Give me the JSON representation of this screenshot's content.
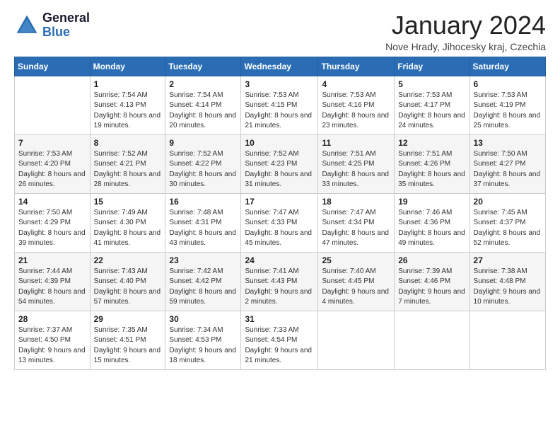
{
  "logo": {
    "line1": "General",
    "line2": "Blue"
  },
  "title": "January 2024",
  "subtitle": "Nove Hrady, Jihocesky kraj, Czechia",
  "days_header": [
    "Sunday",
    "Monday",
    "Tuesday",
    "Wednesday",
    "Thursday",
    "Friday",
    "Saturday"
  ],
  "weeks": [
    [
      {
        "day": "",
        "sunrise": "",
        "sunset": "",
        "daylight": ""
      },
      {
        "day": "1",
        "sunrise": "Sunrise: 7:54 AM",
        "sunset": "Sunset: 4:13 PM",
        "daylight": "Daylight: 8 hours and 19 minutes."
      },
      {
        "day": "2",
        "sunrise": "Sunrise: 7:54 AM",
        "sunset": "Sunset: 4:14 PM",
        "daylight": "Daylight: 8 hours and 20 minutes."
      },
      {
        "day": "3",
        "sunrise": "Sunrise: 7:53 AM",
        "sunset": "Sunset: 4:15 PM",
        "daylight": "Daylight: 8 hours and 21 minutes."
      },
      {
        "day": "4",
        "sunrise": "Sunrise: 7:53 AM",
        "sunset": "Sunset: 4:16 PM",
        "daylight": "Daylight: 8 hours and 23 minutes."
      },
      {
        "day": "5",
        "sunrise": "Sunrise: 7:53 AM",
        "sunset": "Sunset: 4:17 PM",
        "daylight": "Daylight: 8 hours and 24 minutes."
      },
      {
        "day": "6",
        "sunrise": "Sunrise: 7:53 AM",
        "sunset": "Sunset: 4:19 PM",
        "daylight": "Daylight: 8 hours and 25 minutes."
      }
    ],
    [
      {
        "day": "7",
        "sunrise": "Sunrise: 7:53 AM",
        "sunset": "Sunset: 4:20 PM",
        "daylight": "Daylight: 8 hours and 26 minutes."
      },
      {
        "day": "8",
        "sunrise": "Sunrise: 7:52 AM",
        "sunset": "Sunset: 4:21 PM",
        "daylight": "Daylight: 8 hours and 28 minutes."
      },
      {
        "day": "9",
        "sunrise": "Sunrise: 7:52 AM",
        "sunset": "Sunset: 4:22 PM",
        "daylight": "Daylight: 8 hours and 30 minutes."
      },
      {
        "day": "10",
        "sunrise": "Sunrise: 7:52 AM",
        "sunset": "Sunset: 4:23 PM",
        "daylight": "Daylight: 8 hours and 31 minutes."
      },
      {
        "day": "11",
        "sunrise": "Sunrise: 7:51 AM",
        "sunset": "Sunset: 4:25 PM",
        "daylight": "Daylight: 8 hours and 33 minutes."
      },
      {
        "day": "12",
        "sunrise": "Sunrise: 7:51 AM",
        "sunset": "Sunset: 4:26 PM",
        "daylight": "Daylight: 8 hours and 35 minutes."
      },
      {
        "day": "13",
        "sunrise": "Sunrise: 7:50 AM",
        "sunset": "Sunset: 4:27 PM",
        "daylight": "Daylight: 8 hours and 37 minutes."
      }
    ],
    [
      {
        "day": "14",
        "sunrise": "Sunrise: 7:50 AM",
        "sunset": "Sunset: 4:29 PM",
        "daylight": "Daylight: 8 hours and 39 minutes."
      },
      {
        "day": "15",
        "sunrise": "Sunrise: 7:49 AM",
        "sunset": "Sunset: 4:30 PM",
        "daylight": "Daylight: 8 hours and 41 minutes."
      },
      {
        "day": "16",
        "sunrise": "Sunrise: 7:48 AM",
        "sunset": "Sunset: 4:31 PM",
        "daylight": "Daylight: 8 hours and 43 minutes."
      },
      {
        "day": "17",
        "sunrise": "Sunrise: 7:47 AM",
        "sunset": "Sunset: 4:33 PM",
        "daylight": "Daylight: 8 hours and 45 minutes."
      },
      {
        "day": "18",
        "sunrise": "Sunrise: 7:47 AM",
        "sunset": "Sunset: 4:34 PM",
        "daylight": "Daylight: 8 hours and 47 minutes."
      },
      {
        "day": "19",
        "sunrise": "Sunrise: 7:46 AM",
        "sunset": "Sunset: 4:36 PM",
        "daylight": "Daylight: 8 hours and 49 minutes."
      },
      {
        "day": "20",
        "sunrise": "Sunrise: 7:45 AM",
        "sunset": "Sunset: 4:37 PM",
        "daylight": "Daylight: 8 hours and 52 minutes."
      }
    ],
    [
      {
        "day": "21",
        "sunrise": "Sunrise: 7:44 AM",
        "sunset": "Sunset: 4:39 PM",
        "daylight": "Daylight: 8 hours and 54 minutes."
      },
      {
        "day": "22",
        "sunrise": "Sunrise: 7:43 AM",
        "sunset": "Sunset: 4:40 PM",
        "daylight": "Daylight: 8 hours and 57 minutes."
      },
      {
        "day": "23",
        "sunrise": "Sunrise: 7:42 AM",
        "sunset": "Sunset: 4:42 PM",
        "daylight": "Daylight: 8 hours and 59 minutes."
      },
      {
        "day": "24",
        "sunrise": "Sunrise: 7:41 AM",
        "sunset": "Sunset: 4:43 PM",
        "daylight": "Daylight: 9 hours and 2 minutes."
      },
      {
        "day": "25",
        "sunrise": "Sunrise: 7:40 AM",
        "sunset": "Sunset: 4:45 PM",
        "daylight": "Daylight: 9 hours and 4 minutes."
      },
      {
        "day": "26",
        "sunrise": "Sunrise: 7:39 AM",
        "sunset": "Sunset: 4:46 PM",
        "daylight": "Daylight: 9 hours and 7 minutes."
      },
      {
        "day": "27",
        "sunrise": "Sunrise: 7:38 AM",
        "sunset": "Sunset: 4:48 PM",
        "daylight": "Daylight: 9 hours and 10 minutes."
      }
    ],
    [
      {
        "day": "28",
        "sunrise": "Sunrise: 7:37 AM",
        "sunset": "Sunset: 4:50 PM",
        "daylight": "Daylight: 9 hours and 13 minutes."
      },
      {
        "day": "29",
        "sunrise": "Sunrise: 7:35 AM",
        "sunset": "Sunset: 4:51 PM",
        "daylight": "Daylight: 9 hours and 15 minutes."
      },
      {
        "day": "30",
        "sunrise": "Sunrise: 7:34 AM",
        "sunset": "Sunset: 4:53 PM",
        "daylight": "Daylight: 9 hours and 18 minutes."
      },
      {
        "day": "31",
        "sunrise": "Sunrise: 7:33 AM",
        "sunset": "Sunset: 4:54 PM",
        "daylight": "Daylight: 9 hours and 21 minutes."
      },
      {
        "day": "",
        "sunrise": "",
        "sunset": "",
        "daylight": ""
      },
      {
        "day": "",
        "sunrise": "",
        "sunset": "",
        "daylight": ""
      },
      {
        "day": "",
        "sunrise": "",
        "sunset": "",
        "daylight": ""
      }
    ]
  ]
}
